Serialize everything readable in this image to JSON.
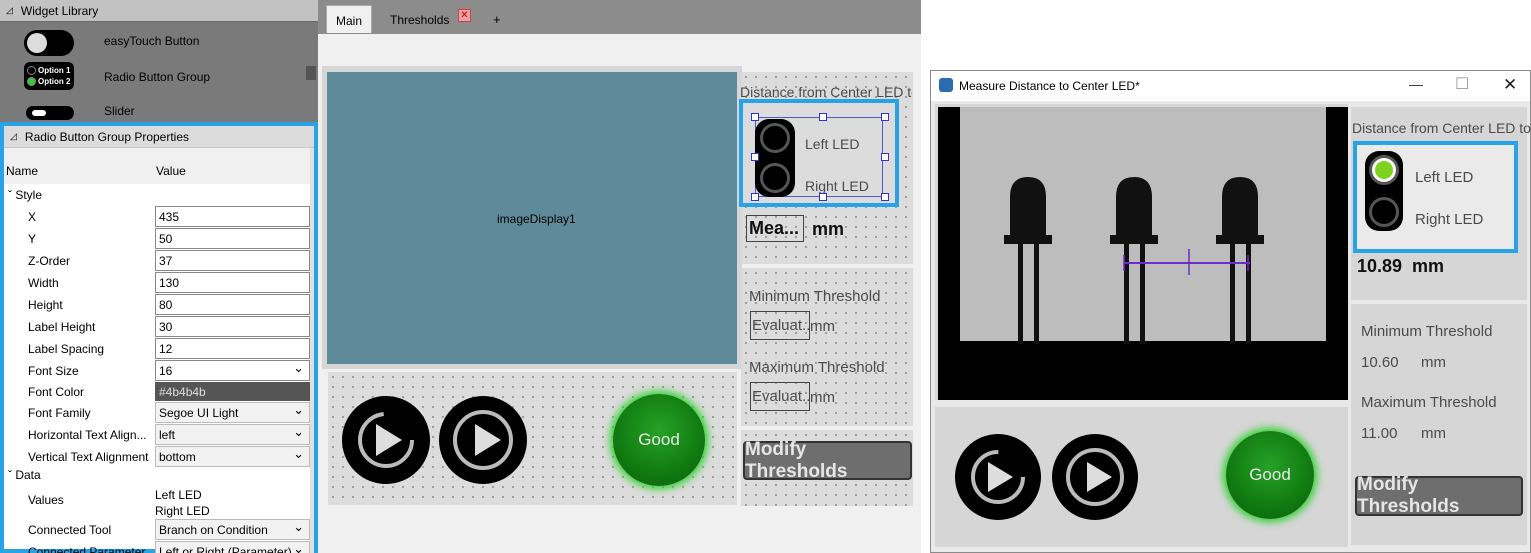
{
  "widget_library": {
    "title": "Widget Library",
    "items": [
      {
        "label": "easyTouch Button",
        "icon": "toggle-icon"
      },
      {
        "label": "Radio Button Group",
        "icon": "radio-group-icon",
        "icon_text": [
          "Option 1",
          "Option 2"
        ]
      },
      {
        "label": "Slider",
        "icon": "slider-icon"
      }
    ]
  },
  "properties": {
    "title": "Radio Button Group Properties",
    "col_name": "Name",
    "col_value": "Value",
    "group_style": "Style",
    "group_data": "Data",
    "rows": [
      {
        "name": "X",
        "value": "435"
      },
      {
        "name": "Y",
        "value": "50"
      },
      {
        "name": "Z-Order",
        "value": "37"
      },
      {
        "name": "Width",
        "value": "130"
      },
      {
        "name": "Height",
        "value": "80"
      },
      {
        "name": "Label Height",
        "value": "30"
      },
      {
        "name": "Label Spacing",
        "value": "12"
      },
      {
        "name": "Font Size",
        "value": "16"
      },
      {
        "name": "Font Color",
        "value": "#4b4b4b"
      },
      {
        "name": "Font Family",
        "value": "Segoe UI Light"
      },
      {
        "name": "Horizontal Text Align...",
        "value": "left"
      },
      {
        "name": "Vertical Text Alignment",
        "value": "bottom"
      }
    ],
    "values_name": "Values",
    "values": [
      "Left LED",
      "Right LED"
    ],
    "connected_tool_name": "Connected Tool",
    "connected_tool_value": "Branch on Condition",
    "connected_param_name": "Connected Parameter",
    "connected_param_value": "Left or Right (Parameter)"
  },
  "designer": {
    "tabs": [
      {
        "label": "Main"
      },
      {
        "label": "Thresholds"
      }
    ],
    "add_tab": "+",
    "image_display_label": "imageDisplay1",
    "distance_label": "Distance from Center LED to",
    "radio_labels": [
      "Left LED",
      "Right LED"
    ],
    "measure_value": "Mea...",
    "unit": "mm",
    "min_threshold_label": "Minimum Threshold",
    "max_threshold_label": "Maximum Threshold",
    "eval_value": "Evaluat...",
    "eval_unit": "mm",
    "good_label": "Good",
    "modify_label": "Modify Thresholds"
  },
  "app": {
    "title": "Measure Distance to Center LED*",
    "distance_label": "Distance from Center LED to",
    "radio_labels": [
      "Left LED",
      "Right LED"
    ],
    "selected_radio": 0,
    "measured_value": "10.89",
    "unit": "mm",
    "min_threshold_label": "Minimum Threshold",
    "min_threshold_value": "10.60",
    "max_threshold_label": "Maximum Threshold",
    "max_threshold_value": "11.00",
    "threshold_unit": "mm",
    "good_label": "Good",
    "modify_label": "Modify Thresholds"
  },
  "colors": {
    "accent_blue": "#29a3e8",
    "good_green": "#107a10",
    "image_bg": "#5f8a99",
    "selected_radio_green": "#7ed321"
  }
}
